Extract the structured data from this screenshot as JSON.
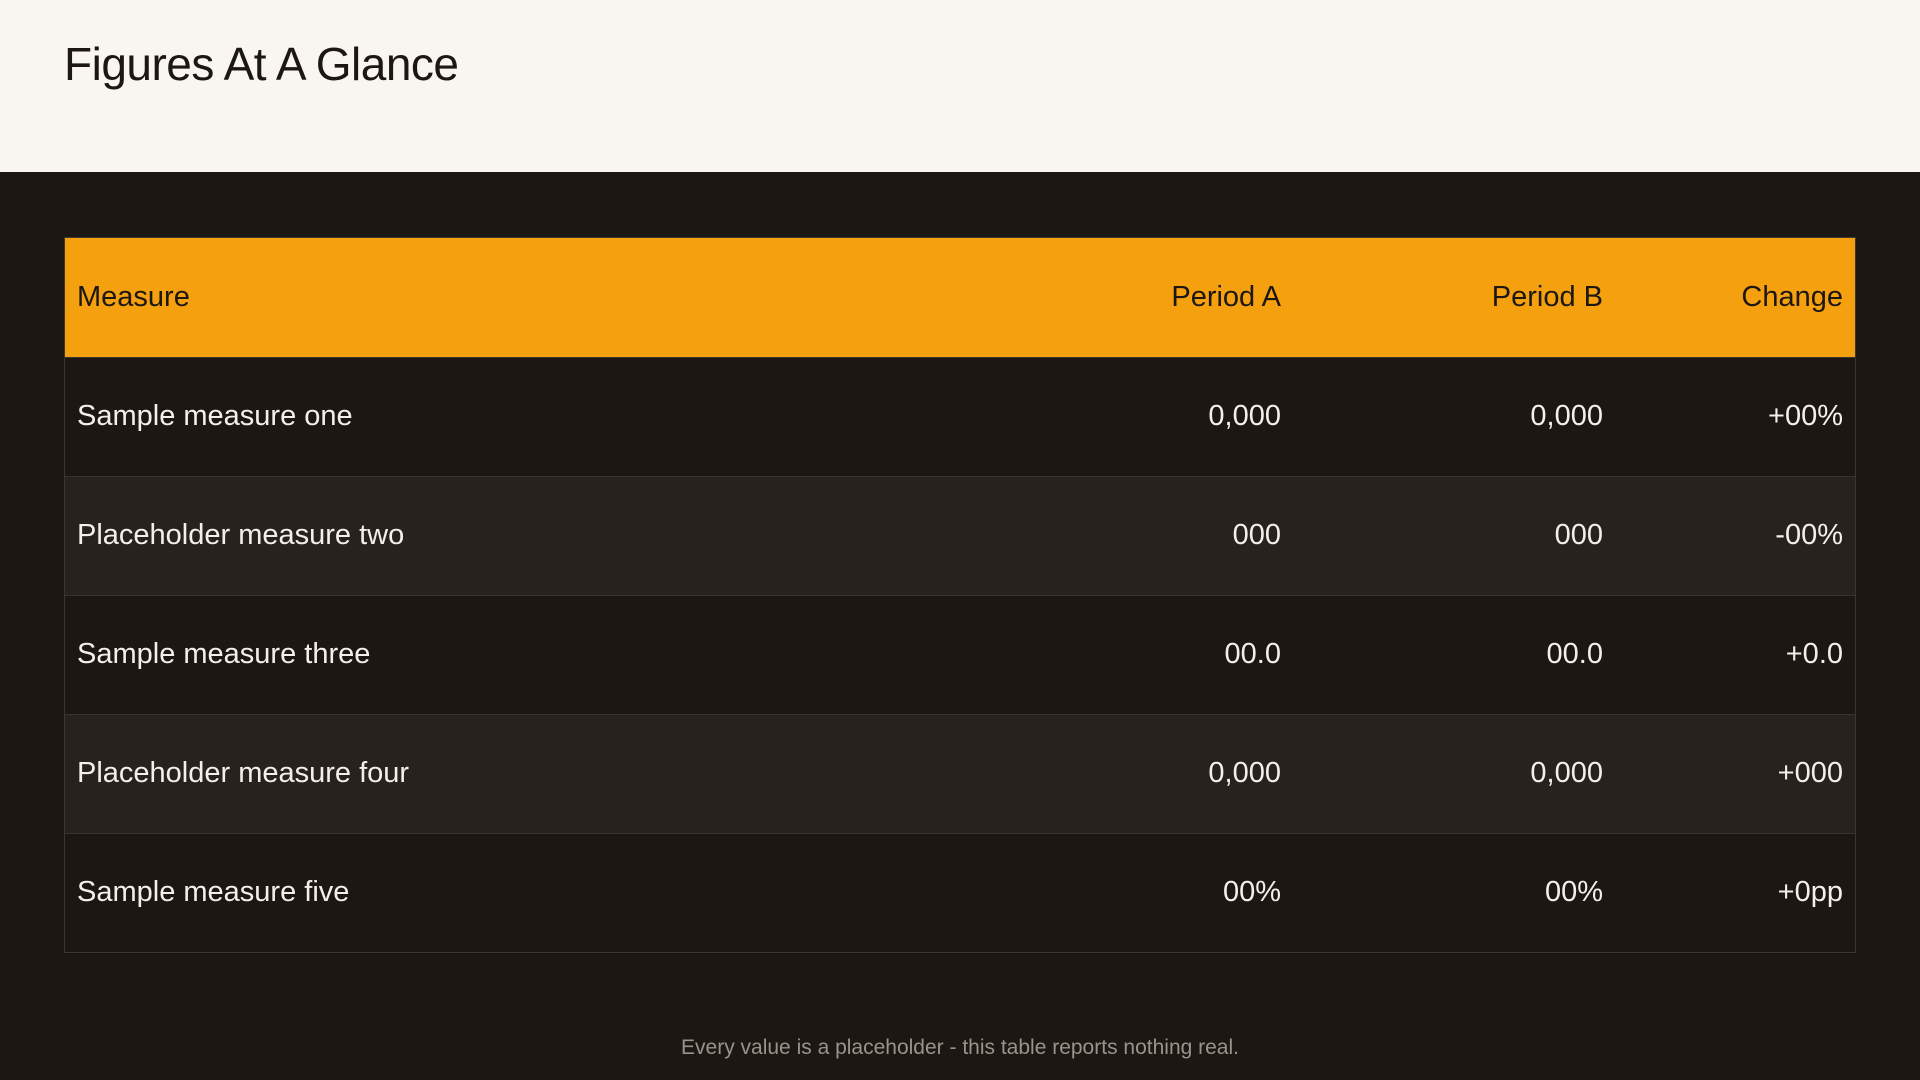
{
  "title": "Figures At A Glance",
  "colors": {
    "accent": "#f5a00f",
    "background_dark": "#1c1713",
    "background_light": "#f9f6f1"
  },
  "table": {
    "headers": [
      "Measure",
      "Period A",
      "Period B",
      "Change"
    ],
    "rows": [
      [
        "Sample measure one",
        "0,000",
        "0,000",
        "+00%"
      ],
      [
        "Placeholder measure two",
        "000",
        "000",
        "-00%"
      ],
      [
        "Sample measure three",
        "00.0",
        "00.0",
        "+0.0"
      ],
      [
        "Placeholder measure four",
        "0,000",
        "0,000",
        "+000"
      ],
      [
        "Sample measure five",
        "00%",
        "00%",
        "+0pp"
      ]
    ]
  },
  "footnote": "Every value is a placeholder  -  this table reports nothing real."
}
